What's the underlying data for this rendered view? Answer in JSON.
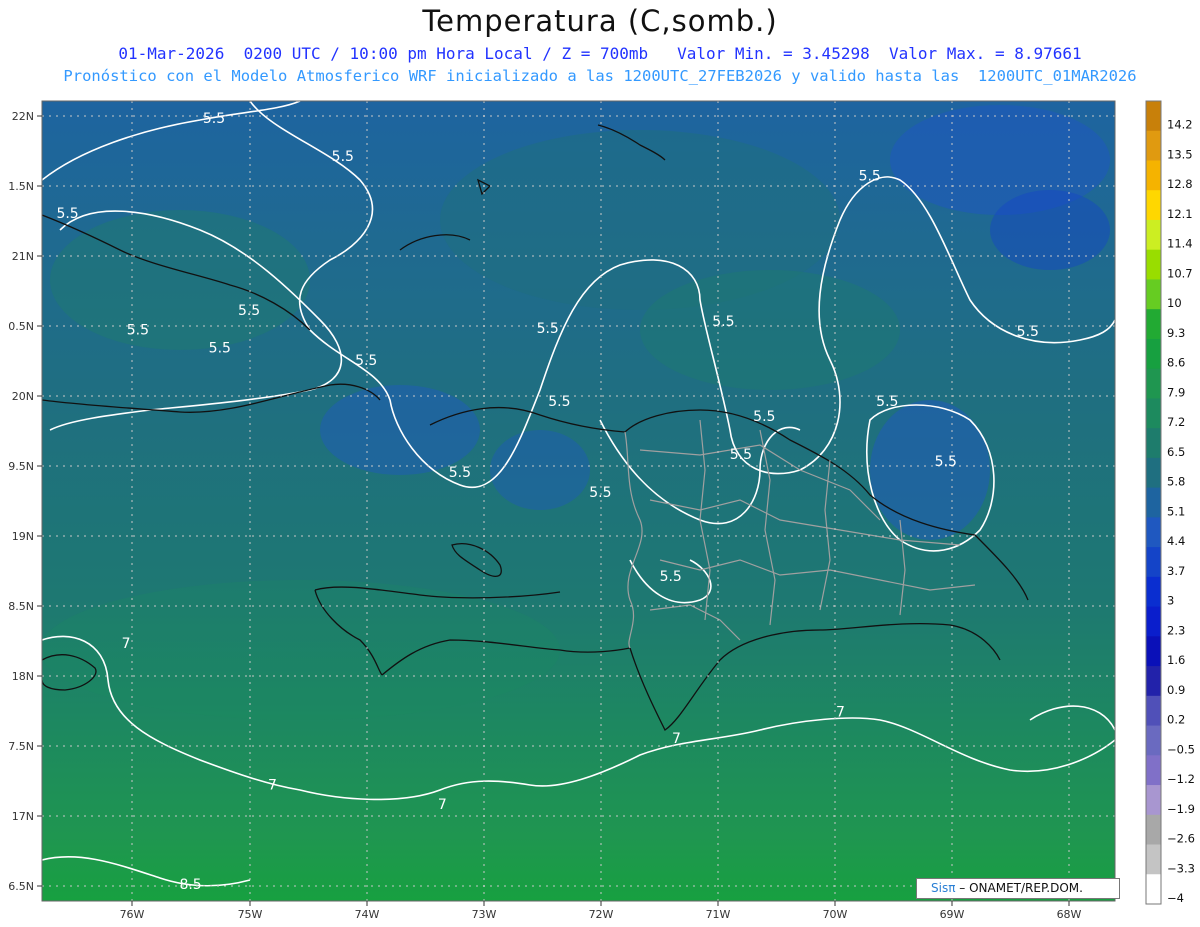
{
  "title": "Temperatura (C,somb.)",
  "subtitle_line1": "01-Mar-2026  0200 UTC / 10:00 pm Hora Local / Z = 700mb   Valor Min. = 3.45298  Valor Max. = 8.97661",
  "subtitle_line2": "Pronóstico con el Modelo Atmosferico WRF inicializado a las 1200UTC_27FEB2026 y valido hasta las  1200UTC_01MAR2026",
  "y_ticks": [
    "22N",
    "1.5N",
    "21N",
    "0.5N",
    "20N",
    "9.5N",
    "19N",
    "8.5N",
    "18N",
    "7.5N",
    "17N",
    "6.5N"
  ],
  "x_ticks": [
    "76W",
    "75W",
    "74W",
    "73W",
    "72W",
    "71W",
    "70W",
    "69W",
    "68W"
  ],
  "colorbar": [
    {
      "label": "14.2",
      "color": "#c8800a"
    },
    {
      "label": "13.5",
      "color": "#e09a10"
    },
    {
      "label": "12.8",
      "color": "#f5b300"
    },
    {
      "label": "12.1",
      "color": "#ffd700"
    },
    {
      "label": "11.4",
      "color": "#ccee22"
    },
    {
      "label": "10.7",
      "color": "#99dd00"
    },
    {
      "label": "10",
      "color": "#66cc22"
    },
    {
      "label": "9.3",
      "color": "#22aa33"
    },
    {
      "label": "8.6",
      "color": "#17a040"
    },
    {
      "label": "7.9",
      "color": "#1f9650"
    },
    {
      "label": "7.2",
      "color": "#1d8a5e"
    },
    {
      "label": "6.5",
      "color": "#1e7c6c"
    },
    {
      "label": "5.8",
      "color": "#1f6f80"
    },
    {
      "label": "5.1",
      "color": "#1e64a0"
    },
    {
      "label": "4.4",
      "color": "#1f58c0"
    },
    {
      "label": "3.7",
      "color": "#1444c8"
    },
    {
      "label": "3",
      "color": "#0a2ed0"
    },
    {
      "label": "2.3",
      "color": "#0a1ecc"
    },
    {
      "label": "1.6",
      "color": "#0a10b8"
    },
    {
      "label": "0.9",
      "color": "#2222aa"
    },
    {
      "label": "0.2",
      "color": "#5050b8"
    },
    {
      "label": "−0.5",
      "color": "#6a6ac0"
    },
    {
      "label": "−1.2",
      "color": "#8070c8"
    },
    {
      "label": "−1.9",
      "color": "#a896d0"
    },
    {
      "label": "−2.6",
      "color": "#a8a8a8"
    },
    {
      "label": "−3.3",
      "color": "#c4c4c4"
    },
    {
      "label": "−4",
      "color": "#ffffff"
    }
  ],
  "contour_labels": [
    {
      "text": "5.5",
      "lon": -75.3,
      "lat": 21.95
    },
    {
      "text": "5.5",
      "lon": -74.2,
      "lat": 21.68
    },
    {
      "text": "5.5",
      "lon": -76.55,
      "lat": 21.27
    },
    {
      "text": "5.5",
      "lon": -75.0,
      "lat": 20.58
    },
    {
      "text": "5.5",
      "lon": -75.95,
      "lat": 20.44
    },
    {
      "text": "5.5",
      "lon": -75.25,
      "lat": 20.31
    },
    {
      "text": "5.5",
      "lon": -74.0,
      "lat": 20.22
    },
    {
      "text": "5.5",
      "lon": -72.45,
      "lat": 20.45
    },
    {
      "text": "5.5",
      "lon": -72.35,
      "lat": 19.93
    },
    {
      "text": "5.5",
      "lon": -70.95,
      "lat": 20.5
    },
    {
      "text": "5.5",
      "lon": -69.7,
      "lat": 21.54
    },
    {
      "text": "5.5",
      "lon": -68.35,
      "lat": 20.43
    },
    {
      "text": "5.5",
      "lon": -70.6,
      "lat": 19.82
    },
    {
      "text": "5.5",
      "lon": -70.8,
      "lat": 19.55
    },
    {
      "text": "5.5",
      "lon": -69.55,
      "lat": 19.93
    },
    {
      "text": "5.5",
      "lon": -69.05,
      "lat": 19.5
    },
    {
      "text": "5.5",
      "lon": -73.2,
      "lat": 19.42
    },
    {
      "text": "5.5",
      "lon": -72.0,
      "lat": 19.28
    },
    {
      "text": "5.5",
      "lon": -71.4,
      "lat": 18.68
    },
    {
      "text": "7",
      "lon": -76.05,
      "lat": 18.2
    },
    {
      "text": "7",
      "lon": -69.95,
      "lat": 17.71
    },
    {
      "text": "7",
      "lon": -71.35,
      "lat": 17.52
    },
    {
      "text": "7",
      "lon": -74.8,
      "lat": 17.19
    },
    {
      "text": "7",
      "lon": -73.35,
      "lat": 17.05
    },
    {
      "text": "8.5",
      "lon": -75.5,
      "lat": 16.48
    }
  ],
  "credit": {
    "sis": "Sisπ",
    "rest": "– ONAMET/REP.DOM."
  }
}
